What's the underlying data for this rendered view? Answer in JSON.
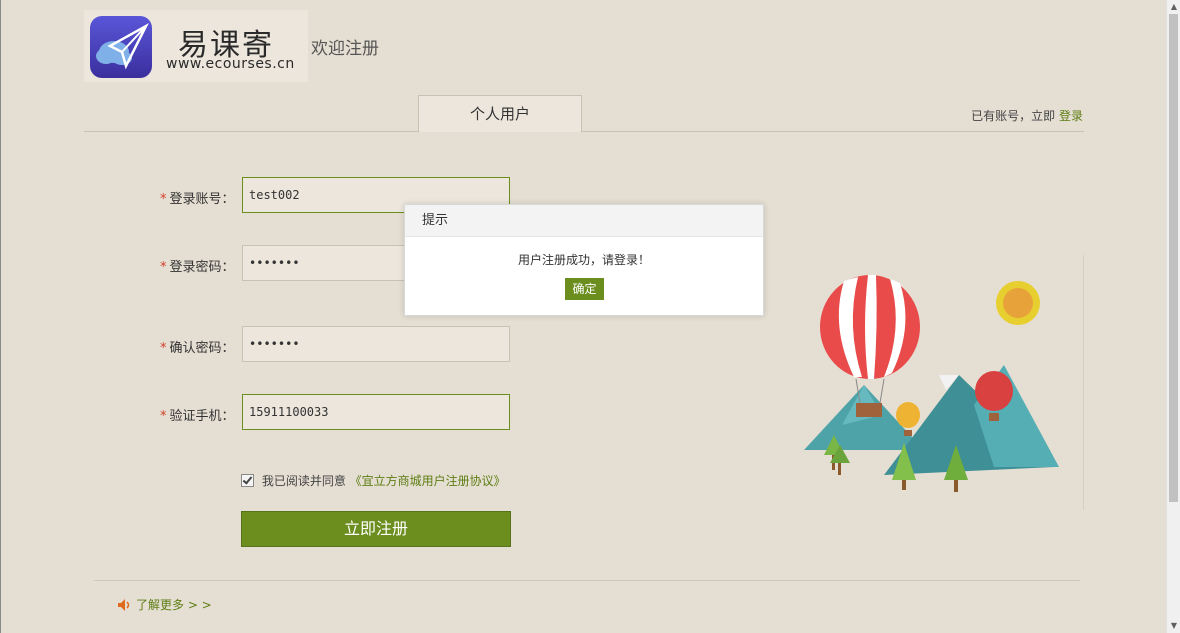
{
  "brand": {
    "title": "易课寄",
    "url": "www.ecourses.cn",
    "welcome": "欢迎注册"
  },
  "tabs": [
    {
      "label": "个人用户",
      "active": true
    }
  ],
  "account": {
    "prompt": "已有账号，立即",
    "login_link": "登录"
  },
  "form": {
    "username": {
      "label": "登录账号：",
      "value": "test002"
    },
    "password": {
      "label": "登录密码：",
      "value": "•••••••"
    },
    "confirm": {
      "label": "确认密码：",
      "value": "•••••••"
    },
    "phone": {
      "label": "验证手机：",
      "value": "15911100033"
    },
    "required_mark": "*",
    "agree_text": "我已阅读并同意",
    "agree_link": "《宜立方商城用户注册协议》",
    "agree_checked": true,
    "submit_label": "立即注册"
  },
  "footer": {
    "more_link": "了解更多 > >"
  },
  "dialog": {
    "title": "提示",
    "message": "用户注册成功，请登录！",
    "ok_label": "确定"
  },
  "colors": {
    "accent": "#6b8e1f",
    "link": "#5c7d12",
    "required": "#d2402a",
    "background": "#e5ded3"
  },
  "icons": [
    "paper-plane-cloud-logo-icon",
    "speaker-icon",
    "checkbox-icon",
    "scroll-up-icon",
    "scroll-down-icon"
  ]
}
